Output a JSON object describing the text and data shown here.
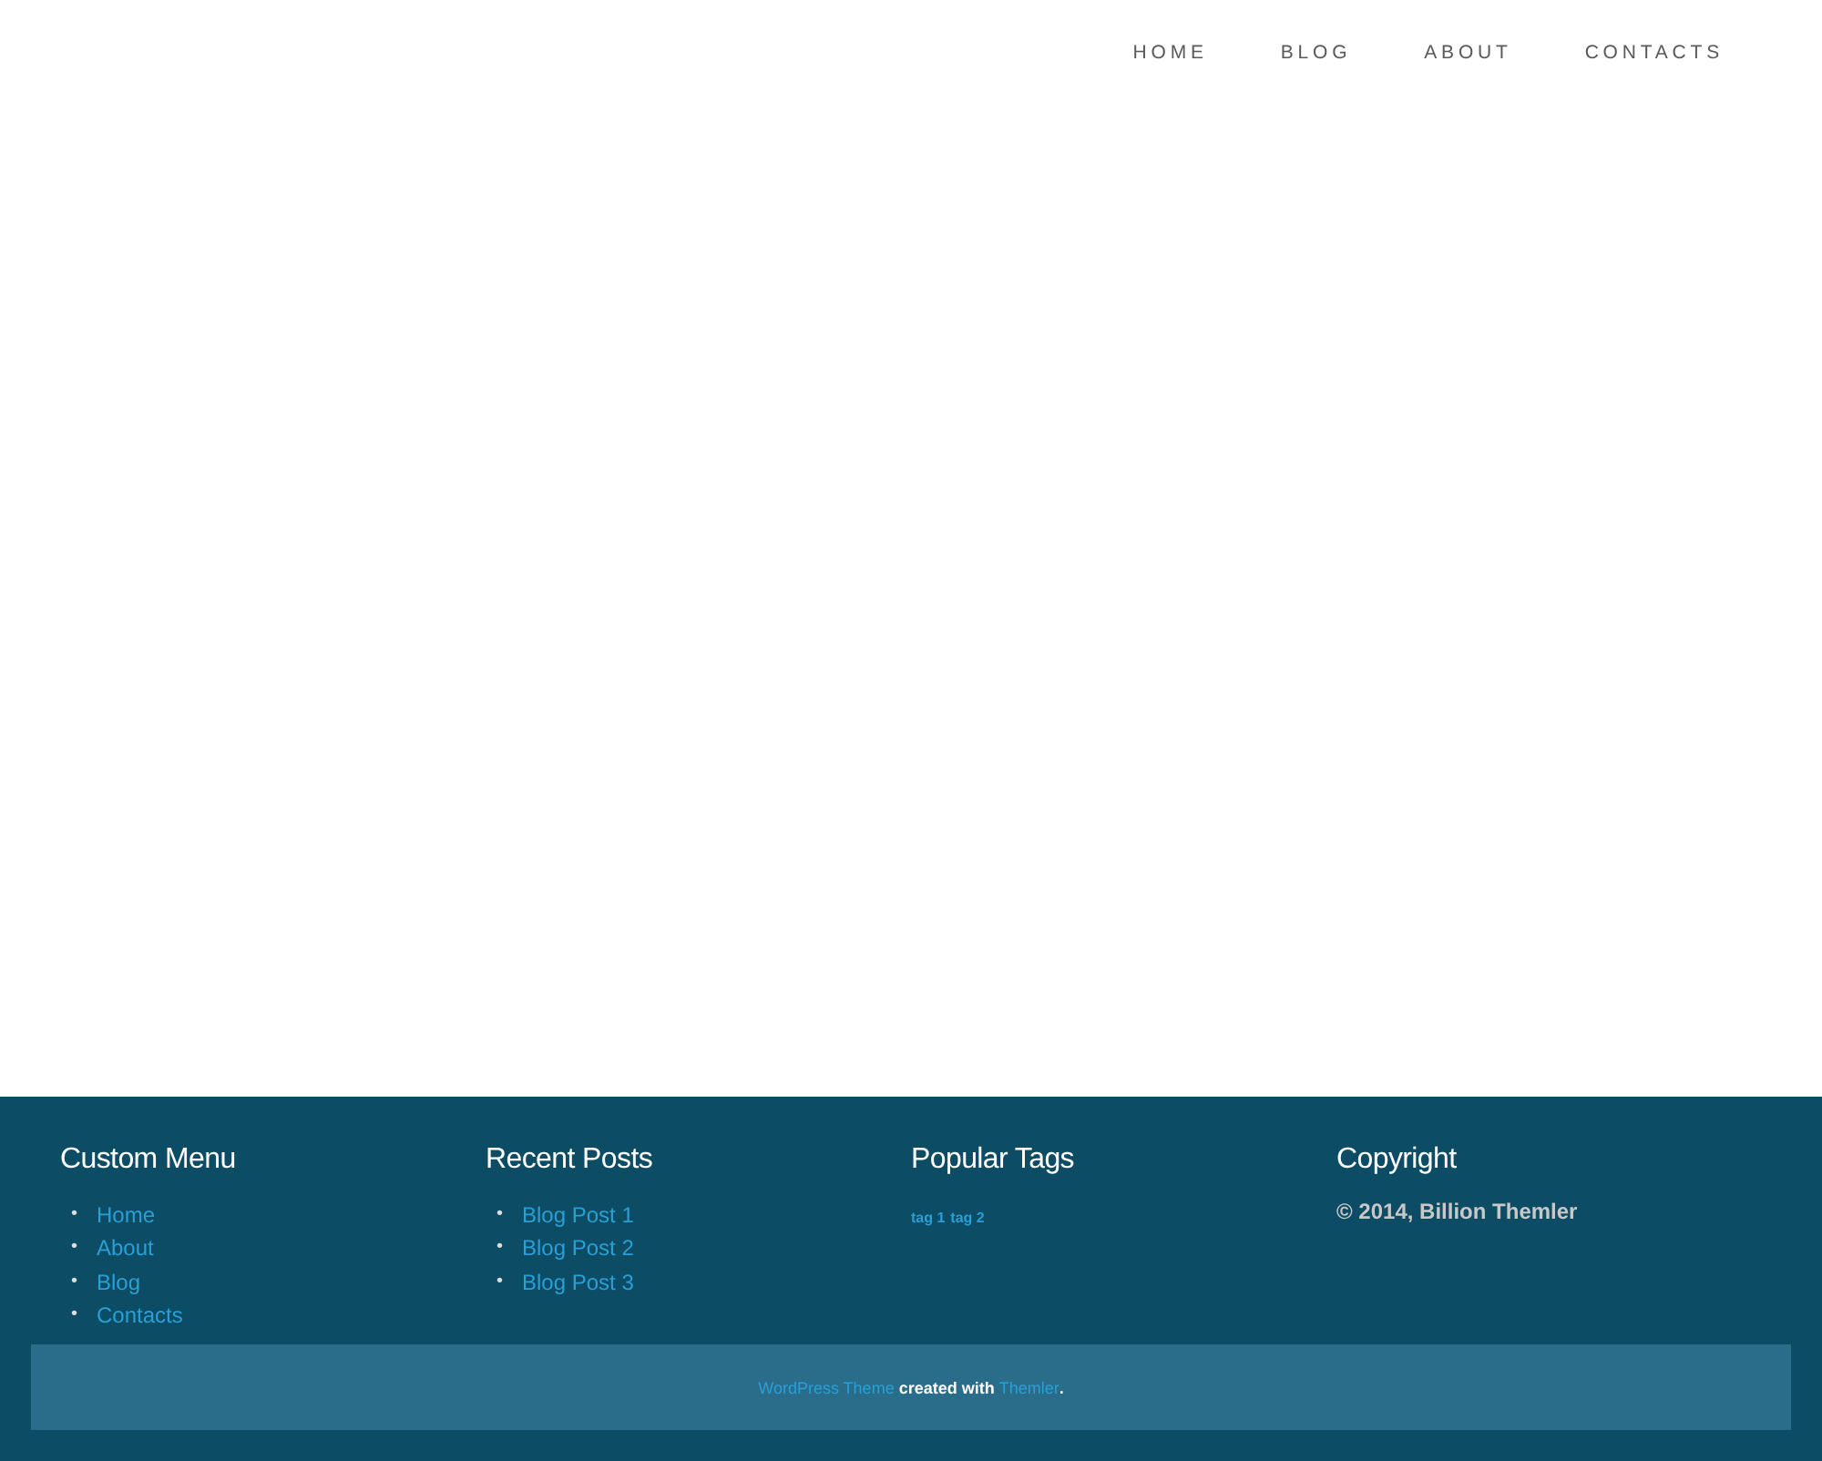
{
  "nav": [
    {
      "label": "HOME"
    },
    {
      "label": "BLOG"
    },
    {
      "label": "ABOUT"
    },
    {
      "label": "CONTACTS"
    }
  ],
  "footer": {
    "columns": [
      {
        "kind": "list",
        "title": "Custom Menu",
        "bullet": "•",
        "items": [
          "Home",
          "About",
          "Blog",
          "Contacts"
        ]
      },
      {
        "kind": "list",
        "title": "Recent Posts",
        "bullet": "•",
        "items": [
          "Blog Post 1",
          "Blog Post 2",
          "Blog Post 3"
        ]
      },
      {
        "kind": "tags",
        "title": "Popular Tags",
        "items": [
          "tag 1",
          "tag 2"
        ]
      },
      {
        "kind": "text",
        "title": "Copyright",
        "text": "© 2014, Billion Themler"
      }
    ],
    "credit": {
      "link": "WordPress Theme",
      "middle": "created with",
      "link2": "Themler",
      "end": "."
    }
  }
}
